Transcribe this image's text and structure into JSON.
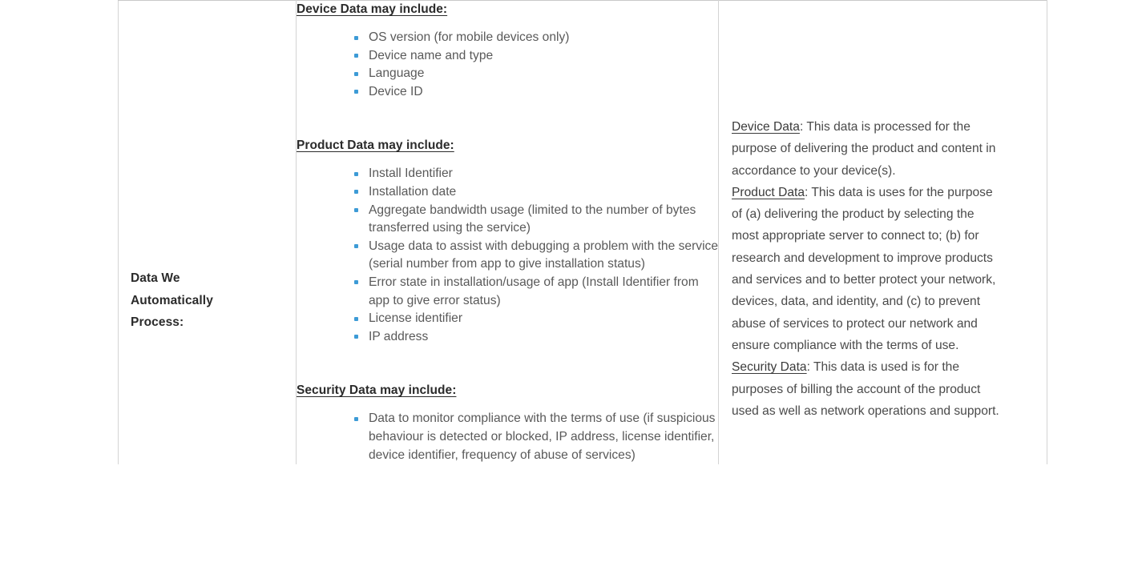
{
  "table": {
    "row_label": "Data We Automatically Process:",
    "row_label_lines": [
      "Data We",
      "Automatically",
      "Process:"
    ],
    "data_types": {
      "sections": [
        {
          "heading": "Device Data may include:",
          "items": [
            "OS version (for mobile devices only)",
            "Device name and type",
            "Language",
            "Device ID"
          ]
        },
        {
          "heading": "Product Data may include:",
          "items": [
            "Install Identifier",
            "Installation date",
            "Aggregate bandwidth usage (limited to the number of bytes transferred using the service)",
            "Usage data to assist with debugging a problem with the service (serial number from app to give installation status)",
            "Error state in installation/usage of app (Install Identifier from app to give error status)",
            "License identifier",
            "IP address"
          ]
        },
        {
          "heading": "Security Data may include:",
          "items": [
            "Data to monitor compliance with the terms of use (if suspicious behaviour is detected or blocked, IP address, license identifier, device identifier, frequency of abuse of services)"
          ]
        }
      ]
    },
    "purposes": [
      {
        "term": "Device Data",
        "text": ": This data is processed for the purpose of delivering the product and content in accordance to your device(s)."
      },
      {
        "term": "Product Data",
        "text": ": This data is uses for the purpose of (a) delivering the product by selecting the most appropriate server to connect to; (b) for research and development to improve products and services and to better protect your network, devices, data, and identity, and (c) to prevent abuse of services to protect our network and ensure compliance with the terms of use."
      },
      {
        "term": "Security Data",
        "text": ": This data is used is for the purposes of billing the account of the product used as well as network operations and support."
      }
    ]
  },
  "colors": {
    "bullet": "#3d9bd6",
    "heading_text": "#2b2b2b",
    "body_text": "#595959",
    "purpose_text": "#4a4a4a",
    "border": "#d4d4d4",
    "background": "#ffffff"
  }
}
